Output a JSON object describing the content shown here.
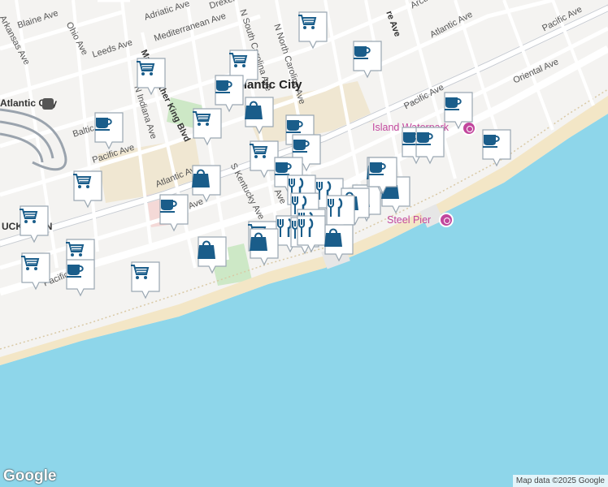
{
  "map": {
    "city_label": "Atlantic City",
    "city_label_west": "Atlantic City",
    "neighborhood_label": "UCKTOWN",
    "pois": [
      {
        "label": "Island Waterpark"
      },
      {
        "label": "Steel Pier"
      }
    ],
    "streets": [
      "Arkansas Ave",
      "Blaine Ave",
      "Ohio Ave",
      "Leeds Ave",
      "Adriatic Ave",
      "Mediterranean Ave",
      "Drexel",
      "N South Carolina Ave",
      "N North Carolina Ave",
      "Arctic",
      "Atlantic Ave",
      "Pacific Ave",
      "Oriental Ave",
      "N Indiana Ave",
      "Baltic",
      "Atlantic Ave",
      "S Kentucky Ave",
      "Pacific Ave",
      "Pacific Ave",
      "Pacific Ave",
      "Pacific Ave",
      "Ave",
      "re Ave",
      "Martin Luther King Blvd"
    ],
    "colors": {
      "land": "#f4f3f1",
      "water": "#8ed6ea",
      "beach": "#f3e6c6",
      "road": "#ffffff",
      "major_road": "#c8ccd2",
      "marker_fill": "#1a5d8a",
      "marker_bg": "#ffffff"
    },
    "marker_types": {
      "shopping": "shopping-cart-icon",
      "coffee": "coffee-cup-icon",
      "bag": "shopping-bag-icon",
      "restaurant": "restaurant-icon"
    },
    "markers": [
      {
        "type": "shopping"
      },
      {
        "type": "coffee"
      },
      {
        "type": "shopping"
      },
      {
        "type": "shopping"
      },
      {
        "type": "coffee"
      },
      {
        "type": "shopping"
      },
      {
        "type": "bag"
      },
      {
        "type": "coffee"
      },
      {
        "type": "shopping"
      },
      {
        "type": "coffee"
      },
      {
        "type": "coffee"
      },
      {
        "type": "coffee"
      },
      {
        "type": "coffee"
      },
      {
        "type": "coffee"
      },
      {
        "type": "shopping"
      },
      {
        "type": "coffee"
      },
      {
        "type": "restaurant"
      },
      {
        "type": "restaurant"
      },
      {
        "type": "bag"
      },
      {
        "type": "bag"
      },
      {
        "type": "shopping"
      },
      {
        "type": "bag"
      },
      {
        "type": "coffee"
      },
      {
        "type": "restaurant"
      },
      {
        "type": "bag"
      },
      {
        "type": "restaurant"
      },
      {
        "type": "restaurant"
      },
      {
        "type": "shopping"
      },
      {
        "type": "restaurant"
      },
      {
        "type": "restaurant"
      },
      {
        "type": "bag"
      },
      {
        "type": "restaurant"
      },
      {
        "type": "bag"
      },
      {
        "type": "bag"
      },
      {
        "type": "bag"
      },
      {
        "type": "shopping"
      },
      {
        "type": "shopping"
      },
      {
        "type": "coffee"
      },
      {
        "type": "shopping"
      },
      {
        "type": "coffee"
      },
      {
        "type": "coffee"
      }
    ]
  },
  "attribution": "Map data ©2025 Google",
  "logo": "Google"
}
